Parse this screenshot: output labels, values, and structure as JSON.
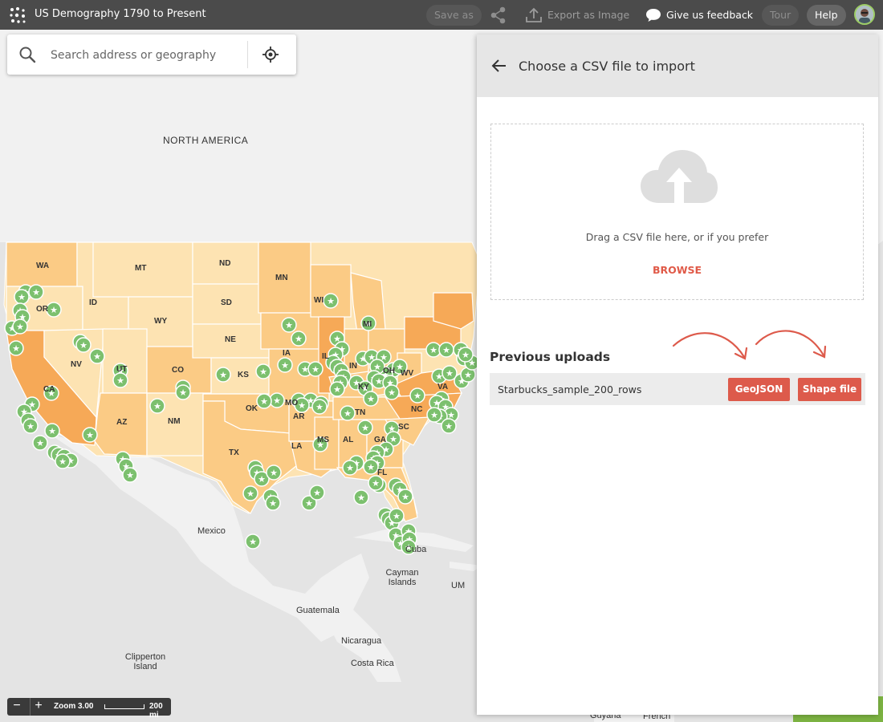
{
  "app": {
    "title": "US Demography 1790 to Present"
  },
  "topbar": {
    "save_as": "Save as",
    "export": "Export as Image",
    "feedback": "Give us feedback",
    "tour": "Tour",
    "help": "Help"
  },
  "search": {
    "placeholder": "Search address or geography"
  },
  "map": {
    "labels": {
      "north_america": "NORTH AMERICA",
      "mexico": "Mexico",
      "cuba": "Cuba",
      "cayman": "Cayman Islands",
      "um": "UM",
      "guatemala": "Guatemala",
      "nicaragua": "Nicaragua",
      "costa_rica": "Costa Rica",
      "clipperton": "Clipperton Island",
      "guyana": "Guyana",
      "french": "French"
    },
    "states": [
      "WA",
      "OR",
      "CA",
      "ID",
      "NV",
      "MT",
      "WY",
      "UT",
      "AZ",
      "CO",
      "NM",
      "ND",
      "SD",
      "NE",
      "KS",
      "OK",
      "TX",
      "MN",
      "IA",
      "MO",
      "AR",
      "LA",
      "WI",
      "IL",
      "MS",
      "MI",
      "IN",
      "KY",
      "TN",
      "AL",
      "GA",
      "FL",
      "OH",
      "WV",
      "VA",
      "NC",
      "SC"
    ],
    "marker_icon": "star-marker-icon",
    "colors": {
      "light": "#fde3b2",
      "mid": "#fbcb85",
      "dark": "#f6a957",
      "marker": "#7cc06e"
    }
  },
  "zoom": {
    "level_label": "Zoom 3.00",
    "scale_label": "200 mi"
  },
  "panel": {
    "title": "Choose a CSV file to import",
    "drop_text": "Drag a CSV file here, or if you prefer",
    "browse": "BROWSE",
    "previous_uploads": "Previous uploads",
    "uploads": [
      {
        "name": "Starbucks_sample_200_rows",
        "geojson": "GeoJSON",
        "shapefile": "Shape file"
      }
    ],
    "accent": "#dd5a4b"
  }
}
